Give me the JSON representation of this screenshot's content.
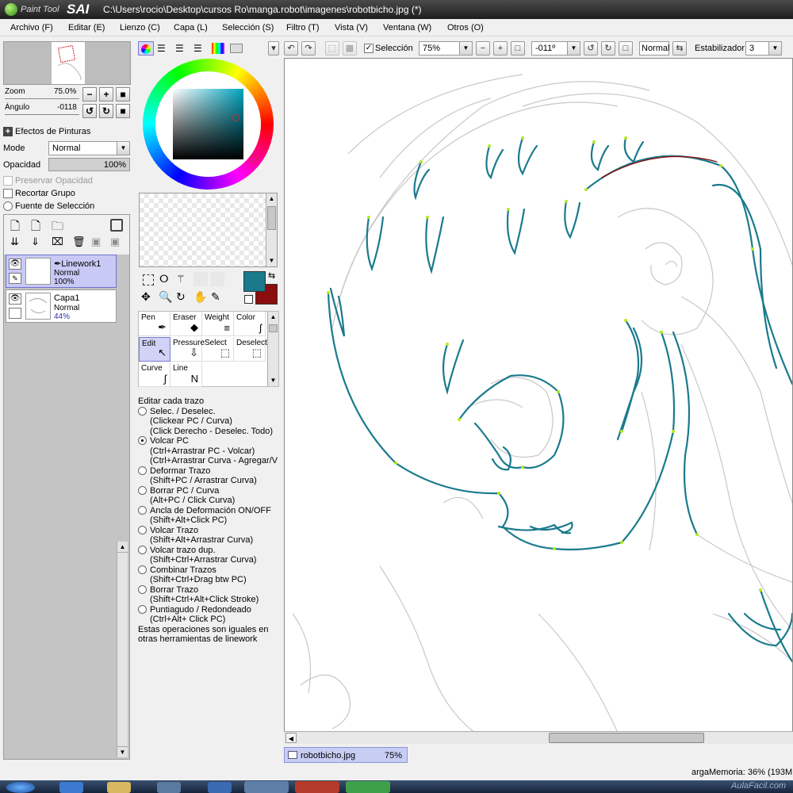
{
  "window": {
    "app_name_small": "Paint Tool",
    "app_name_big": "SAI",
    "title": "C:\\Users\\rocio\\Desktop\\cursos Ro\\manga.robot\\imagenes\\robotbicho.jpg (*)"
  },
  "menu": [
    {
      "label": "Archivo (F)"
    },
    {
      "label": "Editar (E)"
    },
    {
      "label": "Lienzo (C)"
    },
    {
      "label": "Capa (L)"
    },
    {
      "label": "Selección (S)"
    },
    {
      "label": "Filtro (T)"
    },
    {
      "label": "Vista (V)"
    },
    {
      "label": "Ventana (W)"
    },
    {
      "label": "Otros (O)"
    }
  ],
  "toolbar": {
    "selection_label": "Selección",
    "selection_checked": true,
    "zoom_value": "75%",
    "angle_value": "-011º",
    "blend_mode": "Normal",
    "stabilizer_label": "Estabilizador",
    "stabilizer_value": "3"
  },
  "navigator": {
    "zoom_label": "Zoom",
    "zoom_value": "75.0%",
    "angle_label": "Ángulo",
    "angle_value": "-0118"
  },
  "layer_props": {
    "effects_label": "Efectos de Pinturas",
    "mode_label": "Mode",
    "mode_value": "Normal",
    "opacity_label": "Opacidad",
    "opacity_value": "100%",
    "preserve_opacity": "Preservar Opacidad",
    "clip_group": "Recortar Grupo",
    "selection_source": "Fuente de Selección"
  },
  "layers": [
    {
      "name": "Linework1",
      "mode": "Normal",
      "opacity": "100%",
      "selected": true
    },
    {
      "name": "Capa1",
      "mode": "Normal",
      "opacity": "44%",
      "selected": false
    }
  ],
  "colors": {
    "primary": "#1a7a8c",
    "secondary": "#8b0d0d",
    "accent_tab": "#c8cdf4"
  },
  "tools": [
    {
      "label": "Pen",
      "icon": "pen-icon",
      "glyph": "✒"
    },
    {
      "label": "Eraser",
      "icon": "eraser-icon",
      "glyph": "◆"
    },
    {
      "label": "Weight",
      "icon": "weight-icon",
      "glyph": "≡"
    },
    {
      "label": "Color",
      "icon": "color-icon",
      "glyph": "ʃ"
    },
    {
      "label": "Edit",
      "icon": "edit-icon",
      "glyph": "↖",
      "selected": true
    },
    {
      "label": "Pressure",
      "icon": "pressure-icon",
      "glyph": "⇩"
    },
    {
      "label": "Select",
      "icon": "select-icon",
      "glyph": "⬚"
    },
    {
      "label": "Deselect",
      "icon": "deselect-icon",
      "glyph": "⬚"
    },
    {
      "label": "Curve",
      "icon": "curve-icon",
      "glyph": "∫"
    },
    {
      "label": "Line",
      "icon": "line-icon",
      "glyph": "N"
    }
  ],
  "help": {
    "title": "Editar cada trazo",
    "options": [
      {
        "label": "Selec. / Deselec.",
        "details": [
          "(Clickear PC / Curva)",
          "(Click Derecho - Deselec. Todo)"
        ],
        "checked": false
      },
      {
        "label": "Volcar PC",
        "details": [
          "(Ctrl+Arrastrar PC - Volcar)",
          "(Ctrl+Arrastrar Curva - Agregar/V"
        ],
        "checked": true
      },
      {
        "label": "Deformar Trazo",
        "details": [
          "(Shift+PC / Arrastrar Curva)"
        ],
        "checked": false
      },
      {
        "label": "Borrar PC / Curva",
        "details": [
          "(Alt+PC / Click Curva)"
        ],
        "checked": false
      },
      {
        "label": "Ancla de Deformación ON/OFF",
        "details": [
          "(Shift+Alt+Click PC)"
        ],
        "checked": false
      },
      {
        "label": "Volcar Trazo",
        "details": [
          "(Shift+Alt+Arrastrar Curva)"
        ],
        "checked": false
      },
      {
        "label": "Volcar trazo dup.",
        "details": [
          "(Shift+Ctrl+Arrastrar Curva)"
        ],
        "checked": false
      },
      {
        "label": "Combinar Trazos",
        "details": [
          "(Shift+Ctrl+Drag btw PC)"
        ],
        "checked": false
      },
      {
        "label": "Borrar Trazo",
        "details": [
          "(Shift+Ctrl+Alt+Click Stroke)"
        ],
        "checked": false
      },
      {
        "label": "Puntiagudo / Redondeado",
        "details": [
          "(Ctrl+Alt+ Click PC)"
        ],
        "checked": false
      }
    ],
    "footer": [
      "Estas operaciones son iguales en",
      "otras herramientas de linework"
    ]
  },
  "document_tab": {
    "filename": "robotbicho.jpg",
    "zoom": "75%"
  },
  "status": {
    "memory": "argaMemoria: 36% (193MB"
  },
  "watermark": "AulaFacil.com"
}
